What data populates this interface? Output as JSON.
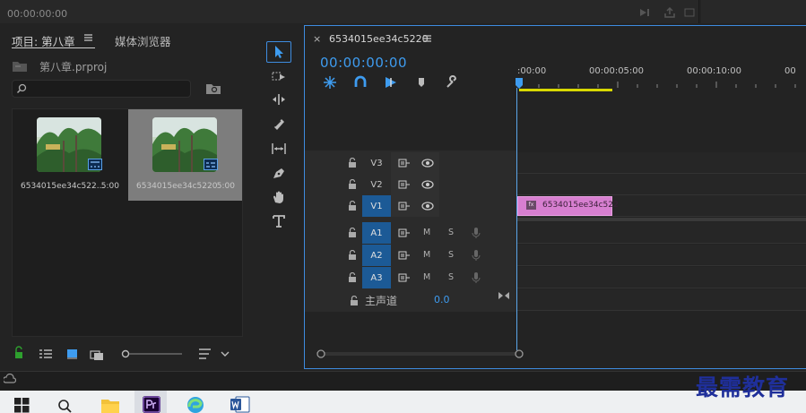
{
  "top_bar": {
    "timecode": "00:00:00:00"
  },
  "project_panel": {
    "tab_label": "项目: 第八章",
    "media_tab_label": "媒体浏览器",
    "file_name": "第八章.prproj",
    "search": {
      "value": "",
      "placeholder": ""
    },
    "clips": [
      {
        "name": "6534015ee34c522...",
        "duration": "5:00",
        "selected": false
      },
      {
        "name": "6534015ee34c5220",
        "duration": "5:00",
        "selected": true
      }
    ]
  },
  "tools": [
    "selection-tool",
    "track-select-tool",
    "ripple-edit-tool",
    "razor-tool",
    "slip-tool",
    "pen-tool",
    "hand-tool",
    "type-tool"
  ],
  "timeline": {
    "sequence_name": "6534015ee34c5220",
    "close_label": "×",
    "timecode": "00:00:00:00",
    "ruler_labels": [
      ":00:00",
      "00:00:05:00",
      "00:00:10:00",
      "00"
    ],
    "video_tracks": [
      {
        "name": "V3",
        "targeted": false
      },
      {
        "name": "V2",
        "targeted": false
      },
      {
        "name": "V1",
        "targeted": true
      }
    ],
    "audio_tracks": [
      {
        "name": "A1",
        "mute": "M",
        "solo": "S"
      },
      {
        "name": "A2",
        "mute": "M",
        "solo": "S"
      },
      {
        "name": "A3",
        "mute": "M",
        "solo": "S"
      }
    ],
    "master": {
      "label": "主声道",
      "value": "0.0"
    },
    "clip_on_v1": {
      "name": "6534015ee34c522",
      "fx_label": "fx"
    }
  },
  "watermark": "最需教育",
  "colors": {
    "accent_blue": "#3e9cf0",
    "clip_pink": "#d77fd0",
    "work_area_yellow": "#d8d800",
    "track_target_blue": "#1c5a96"
  }
}
